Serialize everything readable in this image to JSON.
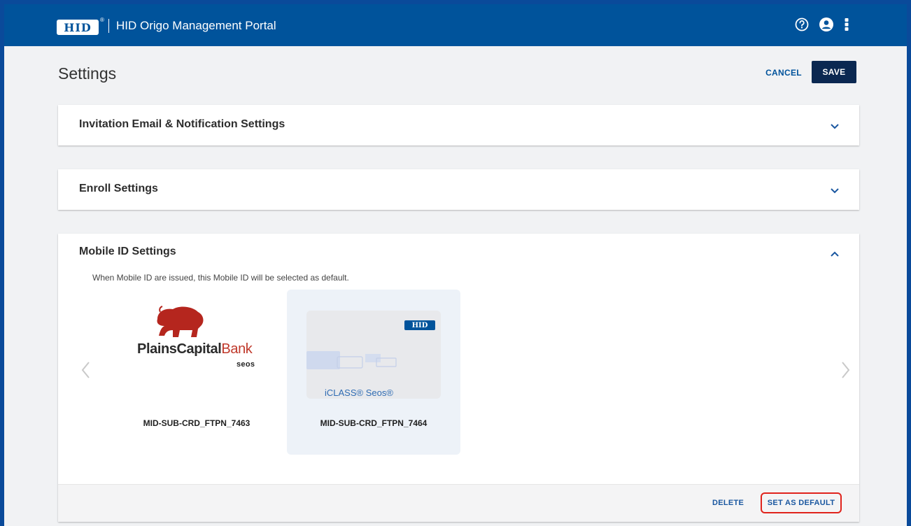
{
  "app": {
    "logo_text": "HID",
    "logo_mark": "®",
    "title": "HID Origo Management Portal"
  },
  "toolbar_icons": [
    "help-icon",
    "account-icon",
    "more-vert-icon"
  ],
  "page": {
    "title": "Settings",
    "cancel_label": "CANCEL",
    "save_label": "SAVE"
  },
  "sections": {
    "invitation": {
      "title": "Invitation Email & Notification Settings",
      "expanded": false
    },
    "enroll": {
      "title": "Enroll Settings",
      "expanded": false
    },
    "mobile_id": {
      "title": "Mobile ID Settings",
      "expanded": true,
      "description": "When Mobile ID are issued, this Mobile ID will be selected as default.",
      "cards": [
        {
          "label": "MID-SUB-CRD_FTPN_7463",
          "brand_part1": "PlainsCapital",
          "brand_part2": "Bank",
          "brand_sub": "seos",
          "selected": false
        },
        {
          "label": "MID-SUB-CRD_FTPN_7464",
          "card_logo": "HID",
          "card_text": "iCLASS® Seos®",
          "selected": true
        }
      ],
      "delete_label": "DELETE",
      "set_default_label": "SET AS DEFAULT"
    }
  },
  "colors": {
    "header": "#00539b",
    "save_button": "#0b2851",
    "accent": "#1a57a0",
    "highlight": "#e0231c",
    "bison": "#b5261e"
  }
}
